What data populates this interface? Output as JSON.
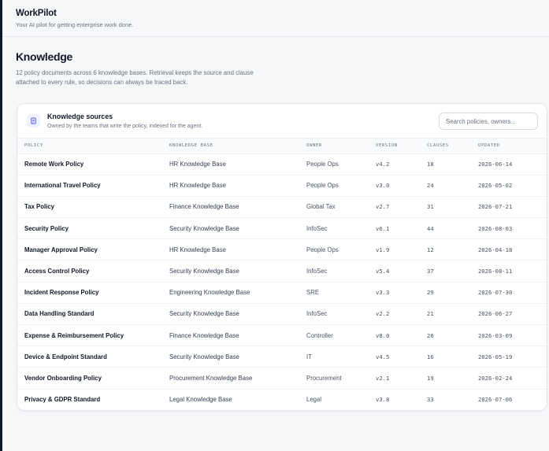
{
  "app": {
    "name": "WorkPilot",
    "tagline": "Your AI pilot for getting enterprise work done."
  },
  "page": {
    "title": "Knowledge",
    "description": "12 policy documents across 6 knowledge bases. Retrieval keeps the source and clause attached to every rule, so decisions can always be traced back."
  },
  "sources": {
    "icon": "document-icon",
    "title": "Knowledge sources",
    "subtitle": "Owned by the teams that write the policy, indexed for the agent.",
    "search_placeholder": "Search policies, owners...",
    "search_value": ""
  },
  "table": {
    "columns": [
      "Policy",
      "Knowledge Base",
      "Owner",
      "Version",
      "Clauses",
      "Updated"
    ],
    "rows": [
      {
        "policy": "Remote Work Policy",
        "kb": "HR Knowledge Base",
        "owner": "People Ops",
        "version": "v4.2",
        "clauses": "18",
        "updated": "2026-06-14"
      },
      {
        "policy": "International Travel Policy",
        "kb": "HR Knowledge Base",
        "owner": "People Ops",
        "version": "v3.0",
        "clauses": "24",
        "updated": "2026-05-02"
      },
      {
        "policy": "Tax Policy",
        "kb": "Finance Knowledge Base",
        "owner": "Global Tax",
        "version": "v2.7",
        "clauses": "31",
        "updated": "2026-07-21"
      },
      {
        "policy": "Security Policy",
        "kb": "Security Knowledge Base",
        "owner": "InfoSec",
        "version": "v6.1",
        "clauses": "44",
        "updated": "2026-08-03"
      },
      {
        "policy": "Manager Approval Policy",
        "kb": "HR Knowledge Base",
        "owner": "People Ops",
        "version": "v1.9",
        "clauses": "12",
        "updated": "2026-04-18"
      },
      {
        "policy": "Access Control Policy",
        "kb": "Security Knowledge Base",
        "owner": "InfoSec",
        "version": "v5.4",
        "clauses": "37",
        "updated": "2026-08-11"
      },
      {
        "policy": "Incident Response Policy",
        "kb": "Engineering Knowledge Base",
        "owner": "SRE",
        "version": "v3.3",
        "clauses": "29",
        "updated": "2026-07-30"
      },
      {
        "policy": "Data Handling Standard",
        "kb": "Security Knowledge Base",
        "owner": "InfoSec",
        "version": "v2.2",
        "clauses": "21",
        "updated": "2026-06-27"
      },
      {
        "policy": "Expense & Reimbursement Policy",
        "kb": "Finance Knowledge Base",
        "owner": "Controller",
        "version": "v8.0",
        "clauses": "26",
        "updated": "2026-03-09"
      },
      {
        "policy": "Device & Endpoint Standard",
        "kb": "Security Knowledge Base",
        "owner": "IT",
        "version": "v4.5",
        "clauses": "16",
        "updated": "2026-05-19"
      },
      {
        "policy": "Vendor Onboarding Policy",
        "kb": "Procurement Knowledge Base",
        "owner": "Procurement",
        "version": "v2.1",
        "clauses": "19",
        "updated": "2026-02-24"
      },
      {
        "policy": "Privacy & GDPR Standard",
        "kb": "Legal Knowledge Base",
        "owner": "Legal",
        "version": "v3.8",
        "clauses": "33",
        "updated": "2026-07-06"
      }
    ]
  },
  "colors": {
    "accent": "#4f46e5",
    "background": "#f6f7f9",
    "text_primary": "#111827",
    "text_muted": "#6b7280"
  }
}
